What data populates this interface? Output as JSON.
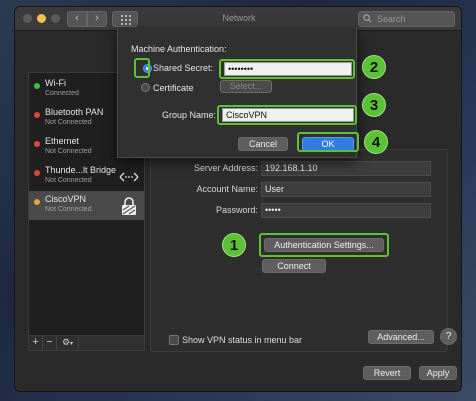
{
  "window": {
    "title": "Network"
  },
  "search": {
    "placeholder": "Search"
  },
  "sidebar": {
    "items": [
      {
        "name": "Wi-Fi",
        "status": "Connected",
        "dot": "#3fbf3f"
      },
      {
        "name": "Bluetooth PAN",
        "status": "Not Connected",
        "dot": "#e0443e"
      },
      {
        "name": "Ethernet",
        "status": "Not Connected",
        "dot": "#e0443e"
      },
      {
        "name": "Thunde...lt Bridge",
        "status": "Not Connected",
        "dot": "#e0443e"
      },
      {
        "name": "CiscoVPN",
        "status": "Not Connected",
        "dot": "#e6a23c"
      }
    ],
    "footer": {
      "add": "+",
      "remove": "−",
      "action": "⚙"
    }
  },
  "sheet": {
    "heading": "Machine Authentication:",
    "shared_secret_label": "Shared Secret:",
    "shared_secret_value": "••••••••",
    "certificate_label": "Certificate",
    "select_label": "Select...",
    "group_name_label": "Group Name:",
    "group_name_value": "CiscoVPN",
    "cancel": "Cancel",
    "ok": "OK"
  },
  "main": {
    "server_address_label": "Server Address:",
    "server_address_value": "192.168.1.10",
    "account_name_label": "Account Name:",
    "account_name_value": "User",
    "password_label": "Password:",
    "password_value": "•••••",
    "auth_settings": "Authentication Settings...",
    "connect": "Connect",
    "show_vpn_status": "Show VPN status in menu bar",
    "advanced": "Advanced...",
    "help": "?"
  },
  "footer": {
    "revert": "Revert",
    "apply": "Apply"
  },
  "annotations": [
    "1",
    "2",
    "3",
    "4"
  ],
  "colors": {
    "highlight_green": "#5bc236",
    "ok_blue": "#2f7de1",
    "radio_blue": "#2f7de1"
  }
}
